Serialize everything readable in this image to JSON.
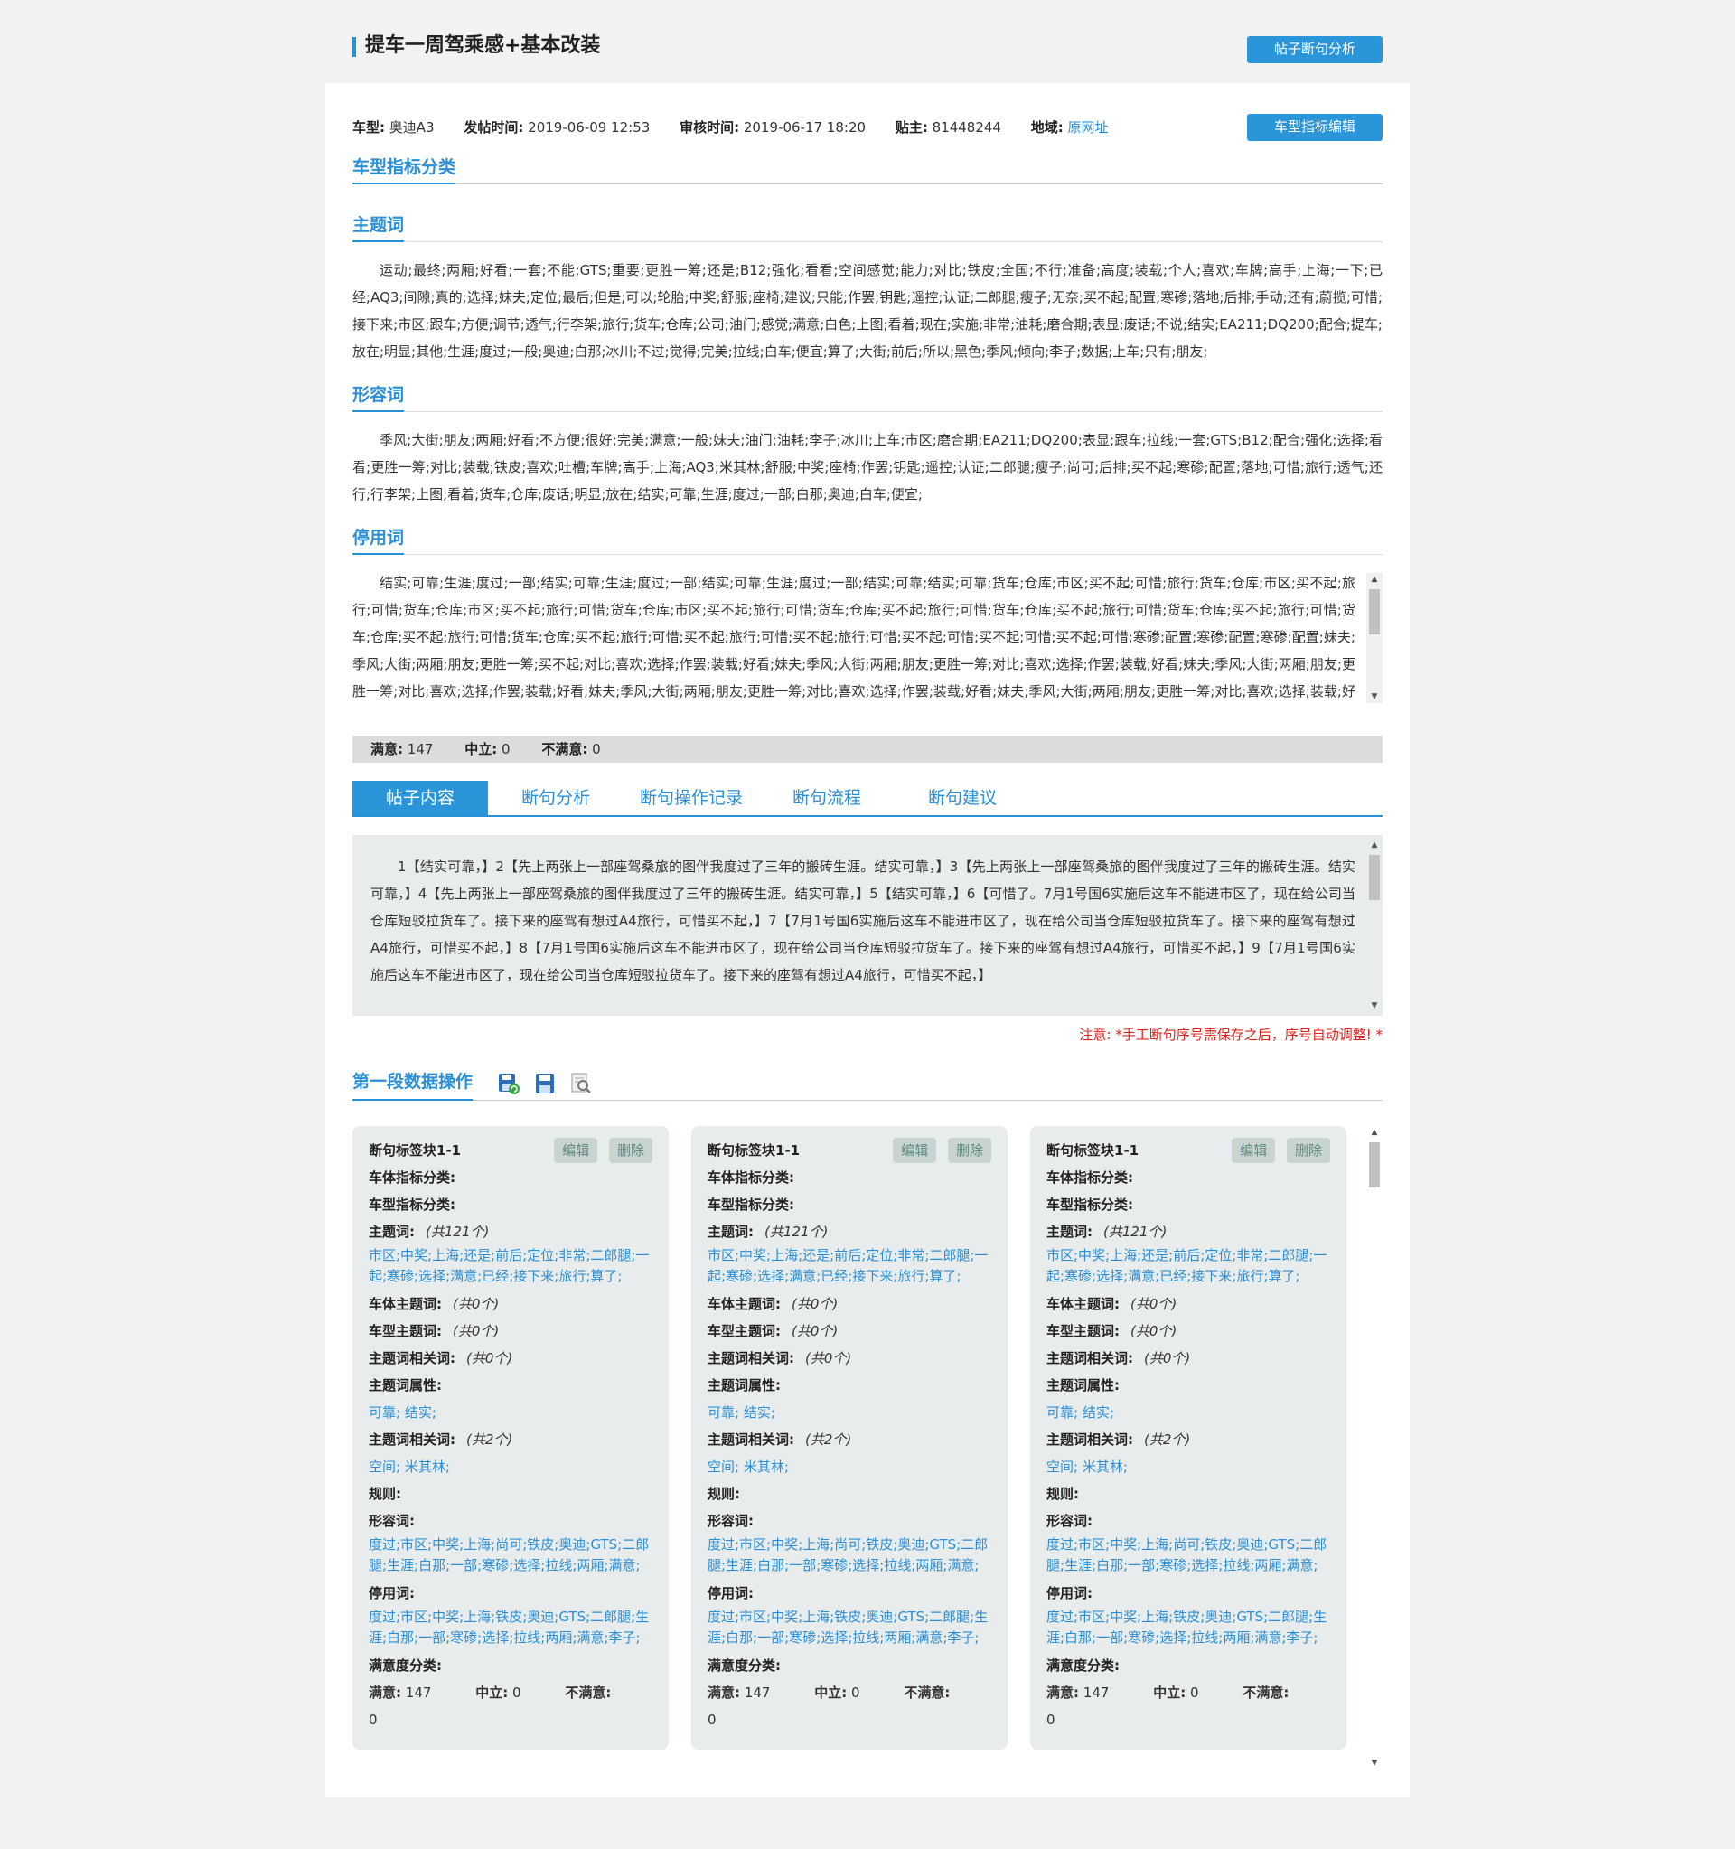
{
  "header": {
    "title": "提车一周驾乘感+基本改装",
    "analyze_btn": "帖子断句分析"
  },
  "meta": {
    "car_key": "车型:",
    "car_val": "奥迪A3",
    "post_time_key": "发帖时间:",
    "post_time_val": "2019-06-09 12:53",
    "review_time_key": "审核时间:",
    "review_time_val": "2019-06-17 18:20",
    "author_key": "贴主:",
    "author_val": "81448244",
    "region_key": "地域:",
    "region_link": "原网址",
    "edit_btn": "车型指标编辑"
  },
  "category_title": "车型指标分类",
  "sections": {
    "topic_title": "主题词",
    "topic_text": "运动;最终;两厢;好看;一套;不能;GTS;重要;更胜一筹;还是;B12;强化;看看;空间感觉;能力;对比;铁皮;全国;不行;准备;高度;装载;个人;喜欢;车牌;高手;上海;一下;已经;AQ3;间隙;真的;选择;妹夫;定位;最后;但是;可以;轮胎;中奖;舒服;座椅;建议;只能;作罢;钥匙;遥控;认证;二郎腿;瘦子;无奈;买不起;配置;寒碜;落地;后排;手动;还有;蔚揽;可惜;接下来;市区;跟车;方便;调节;透气;行李架;旅行;货车;仓库;公司;油门;感觉;满意;白色;上图;看着;现在;实施;非常;油耗;磨合期;表显;废话;不说;结实;EA211;DQ200;配合;提车;放在;明显;其他;生涯;度过;一般;奥迪;白那;冰川;不过;觉得;完美;拉线;白车;便宜;算了;大街;前后;所以;黑色;季风;倾向;李子;数据;上车;只有;朋友;",
    "adj_title": "形容词",
    "adj_text": "季风;大街;朋友;两厢;好看;不方便;很好;完美;满意;一般;妹夫;油门;油耗;李子;冰川;上车;市区;磨合期;EA211;DQ200;表显;跟车;拉线;一套;GTS;B12;配合;强化;选择;看看;更胜一筹;对比;装载;铁皮;喜欢;吐槽;车牌;高手;上海;AQ3;米其林;舒服;中奖;座椅;作罢;钥匙;遥控;认证;二郎腿;瘦子;尚可;后排;买不起;寒碜;配置;落地;可惜;旅行;透气;还行;行李架;上图;看着;货车;仓库;废话;明显;放在;结实;可靠;生涯;度过;一部;白那;奥迪;白车;便宜;",
    "stop_title": "停用词",
    "stop_text": "结实;可靠;生涯;度过;一部;结实;可靠;生涯;度过;一部;结实;可靠;生涯;度过;一部;结实;可靠;结实;可靠;货车;仓库;市区;买不起;可惜;旅行;货车;仓库;市区;买不起;旅行;可惜;货车;仓库;市区;买不起;旅行;可惜;货车;仓库;市区;买不起;旅行;可惜;货车;仓库;买不起;旅行;可惜;货车;仓库;买不起;旅行;可惜;货车;仓库;买不起;旅行;可惜;货车;仓库;买不起;旅行;可惜;货车;仓库;买不起;旅行;可惜;买不起;旅行;可惜;买不起;旅行;可惜;买不起;可惜;买不起;可惜;买不起;可惜;寒碜;配置;寒碜;配置;寒碜;配置;妹夫;季风;大街;两厢;朋友;更胜一筹;买不起;对比;喜欢;选择;作罢;装载;好看;妹夫;季风;大街;两厢;朋友;更胜一筹;对比;喜欢;选择;作罢;装载;好看;妹夫;季风;大街;两厢;朋友;更胜一筹;对比;喜欢;选择;作罢;装载;好看;妹夫;季风;大街;两厢;朋友;更胜一筹;对比;喜欢;选择;作罢;装载;好看;妹夫;季风;大街;两厢;朋友;更胜一筹;对比;喜欢;选择;装载;好看;妹夫;季风;"
  },
  "stats": {
    "sat_key": "满意:",
    "sat_val": "147",
    "neu_key": "中立:",
    "neu_val": "0",
    "dis_key": "不满意:",
    "dis_val": "0"
  },
  "tabs": [
    "帖子内容",
    "断句分析",
    "断句操作记录",
    "断句流程",
    "断句建议"
  ],
  "post_content": "1【结实可靠，】2【先上两张上一部座驾桑旅的图伴我度过了三年的搬砖生涯。结实可靠，】3【先上两张上一部座驾桑旅的图伴我度过了三年的搬砖生涯。结实可靠，】4【先上两张上一部座驾桑旅的图伴我度过了三年的搬砖生涯。结实可靠，】5【结实可靠，】6【可惜了。7月1号国6实施后这车不能进市区了，现在给公司当仓库短驳拉货车了。接下来的座驾有想过A4旅行，可惜买不起，】7【7月1号国6实施后这车不能进市区了，现在给公司当仓库短驳拉货车了。接下来的座驾有想过A4旅行，可惜买不起，】8【7月1号国6实施后这车不能进市区了，现在给公司当仓库短驳拉货车了。接下来的座驾有想过A4旅行，可惜买不起，】9【7月1号国6实施后这车不能进市区了，现在给公司当仓库短驳拉货车了。接下来的座驾有想过A4旅行，可惜买不起，】",
  "notice": "注意: *手工断句序号需保存之后，序号自动调整! *",
  "ops": {
    "title": "第一段数据操作"
  },
  "card": {
    "title": "断句标签块1-1",
    "edit": "编辑",
    "delete": "删除",
    "body_cat": "车体指标分类:",
    "model_cat": "车型指标分类:",
    "topic": "主题词:",
    "topic_count": "(共121个)",
    "topic_words": "市区;中奖;上海;还是;前后;定位;非常;二郎腿;一起;寒碜;选择;满意;已经;接下来;旅行;算了;",
    "body_topic": "车体主题词:",
    "body_topic_count": "(共0个)",
    "model_topic": "车型主题词:",
    "model_topic_count": "(共0个)",
    "topic_related": "主题词相关词:",
    "topic_related_count": "(共0个)",
    "topic_attr": "主题词属性:",
    "topic_attr_words": "可靠; 结实;",
    "topic_related2": "主题词相关词:",
    "topic_related2_count": "(共2个)",
    "topic_related2_words": "空间; 米其林;",
    "rules": "规则:",
    "adj": "形容词:",
    "adj_words": "度过;市区;中奖;上海;尚可;铁皮;奥迪;GTS;二郎腿;生涯;白那;一部;寒碜;选择;拉线;两厢;满意;",
    "stop": "停用词:",
    "stop_words": "度过;市区;中奖;上海;铁皮;奥迪;GTS;二郎腿;生涯;白那;一部;寒碜;选择;拉线;两厢;满意;李子;",
    "sat_cat": "满意度分类:",
    "sat_key": "满意:",
    "sat_val": "147",
    "neu_key": "中立:",
    "neu_val": "0",
    "dis_key": "不满意:",
    "dis_val": "0"
  }
}
